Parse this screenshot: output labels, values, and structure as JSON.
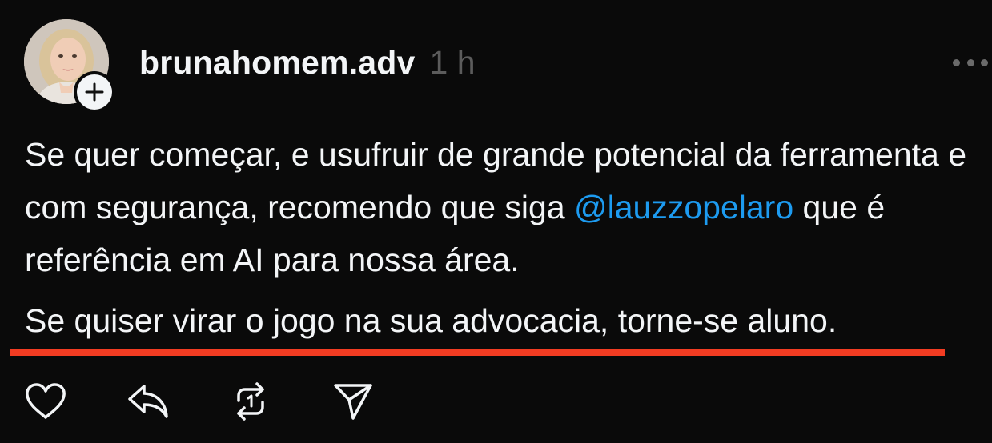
{
  "post": {
    "author": {
      "username": "brunahomem.adv",
      "avatar_icon": "avatar-photo",
      "follow_icon": "plus-icon"
    },
    "timestamp": "1 h",
    "more_icon": "more-horizontal-icon",
    "paragraph1": {
      "before": "Se quer começar, e usufruir de grande potencial da ferramenta e com segurança, recomendo que siga ",
      "mention": "@lauzzopelaro",
      "after": " que é referência em AI para nossa área."
    },
    "paragraph2": "Se quiser virar o jogo na sua advocacia, torne-se aluno.",
    "actions": [
      {
        "name": "like",
        "icon": "heart-icon"
      },
      {
        "name": "reply",
        "icon": "reply-icon"
      },
      {
        "name": "repost",
        "icon": "repost-icon"
      },
      {
        "name": "share",
        "icon": "send-icon"
      }
    ]
  },
  "colors": {
    "background": "#0a0a0a",
    "text": "#f3f5f7",
    "muted": "#5c5c5c",
    "mention": "#1d9bf0",
    "highlight_underline": "#f23c22"
  }
}
